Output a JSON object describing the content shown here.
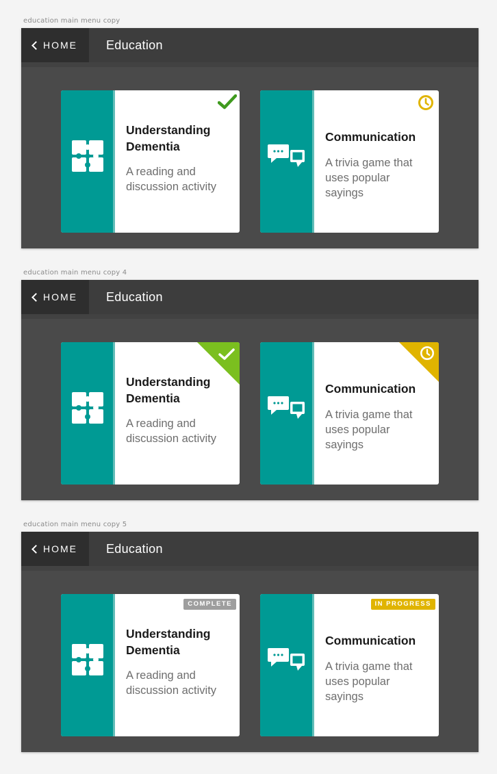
{
  "colors": {
    "teal": "#009a94",
    "complete_green": "#3f9a1e",
    "complete_corner": "#7bbf1f",
    "in_progress_yellow": "#e0b400",
    "header_bg": "#3d3d3d",
    "frame_bg": "#4a4a4a"
  },
  "artboards": [
    {
      "label": "education main menu copy",
      "header": {
        "home_label": "HOME",
        "title": "Education"
      },
      "cards": [
        {
          "title": "Understanding Dementia",
          "description": "A reading and discussion activity",
          "icon": "puzzle-icon",
          "status": "complete",
          "status_icon": "checkmark-icon"
        },
        {
          "title": "Communication",
          "description": "A trivia game that uses popular sayings",
          "icon": "speech-bubbles-icon",
          "status": "in-progress",
          "status_icon": "clock-icon"
        }
      ]
    },
    {
      "label": "education main menu copy 4",
      "header": {
        "home_label": "HOME",
        "title": "Education"
      },
      "cards": [
        {
          "title": "Understanding Dementia",
          "description": "A reading and discussion activity",
          "icon": "puzzle-icon",
          "status": "complete",
          "status_icon": "checkmark-icon"
        },
        {
          "title": "Communication",
          "description": "A trivia game that uses popular sayings",
          "icon": "speech-bubbles-icon",
          "status": "in-progress",
          "status_icon": "clock-icon"
        }
      ]
    },
    {
      "label": "education main menu copy 5",
      "header": {
        "home_label": "HOME",
        "title": "Education"
      },
      "cards": [
        {
          "title": "Understanding Dementia",
          "description": "A reading and discussion activity",
          "icon": "puzzle-icon",
          "status": "complete",
          "badge": "COMPLETE"
        },
        {
          "title": "Communication",
          "description": "A trivia game that uses popular sayings",
          "icon": "speech-bubbles-icon",
          "status": "in-progress",
          "badge": "IN PROGRESS"
        }
      ]
    }
  ]
}
